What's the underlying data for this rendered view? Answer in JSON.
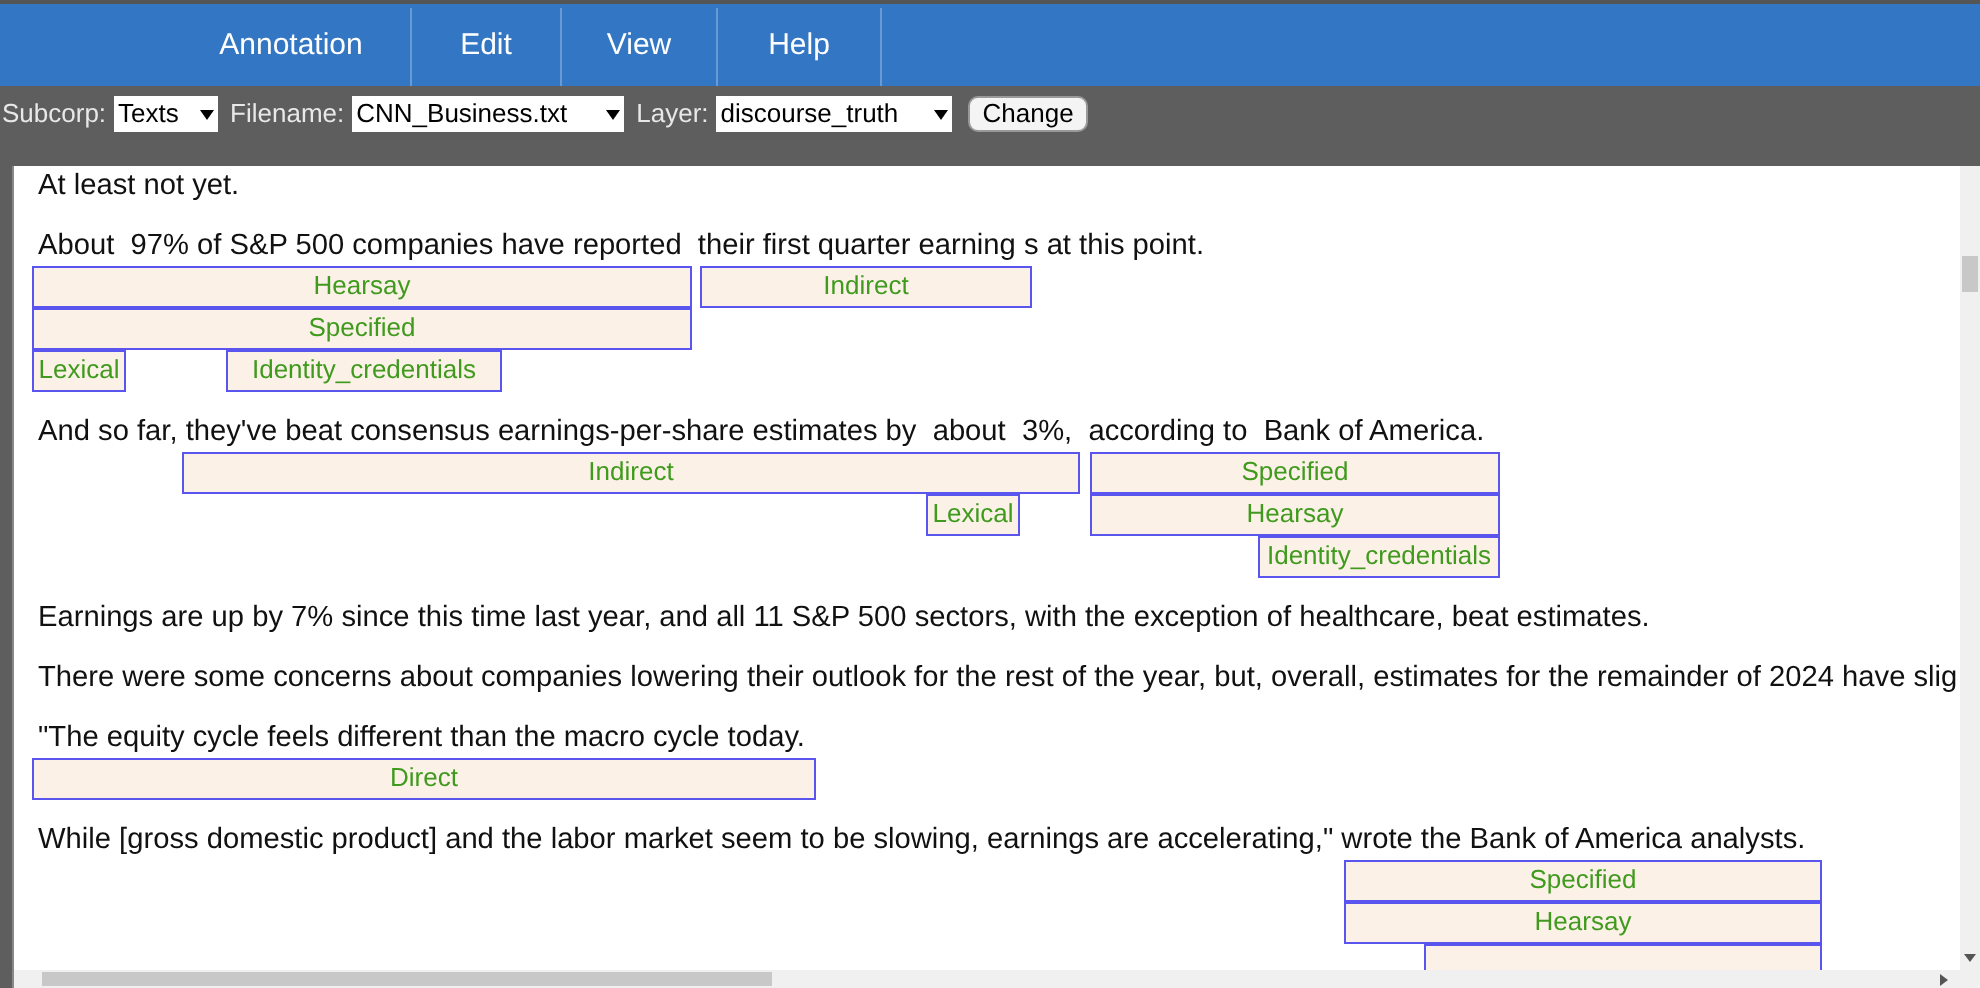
{
  "menu": [
    {
      "label": "Annotation"
    },
    {
      "label": "Edit"
    },
    {
      "label": "View"
    },
    {
      "label": "Help"
    }
  ],
  "toolbar": {
    "fields": [
      {
        "label": "Subcorp:",
        "value": "Texts"
      },
      {
        "label": "Filename:",
        "value": "CNN_Business.txt"
      },
      {
        "label": "Layer:",
        "value": "discourse_truth"
      }
    ],
    "button": "Change"
  },
  "document": {
    "paragraphs": [
      {
        "text": "At least not yet."
      },
      {
        "text": "About  97% of S&P 500 companies have reported  their first quarter earning s at this point.",
        "annotation_rows": [
          [
            {
              "label": "Hearsay"
            },
            {
              "label": "Indirect"
            }
          ],
          [
            {
              "label": "Specified"
            }
          ],
          [
            {
              "label": "Lexical"
            },
            {
              "label": "Identity_credentials"
            }
          ]
        ]
      },
      {
        "text": "And so far, they've beat consensus earnings-per-share estimates by  about  3%,  according to  Bank of America.",
        "annotation_rows": [
          [
            {
              "label": "Indirect"
            },
            {
              "label": "Specified"
            }
          ],
          [
            {
              "label": "Lexical"
            },
            {
              "label": "Hearsay"
            }
          ],
          [
            {
              "label": "Identity_credentials"
            }
          ]
        ]
      },
      {
        "text": "Earnings are up by 7% since this time last year, and all 11 S&P 500 sectors, with the exception of healthcare, beat estimates."
      },
      {
        "text": "There were some concerns about companies lowering their outlook for the rest of the year, but, overall, estimates for the remainder of 2024 have slig"
      },
      {
        "text": "\"The equity cycle feels different than the macro cycle today.",
        "annotation_rows": [
          [
            {
              "label": "Direct"
            }
          ]
        ]
      },
      {
        "text": "While [gross domestic product] and the labor market seem to be slowing, earnings are accelerating,\" wrote the Bank of America analysts.",
        "annotation_rows": [
          [
            {
              "label": "Specified"
            }
          ],
          [
            {
              "label": "Hearsay"
            }
          ],
          [
            {}
          ]
        ]
      }
    ]
  }
}
